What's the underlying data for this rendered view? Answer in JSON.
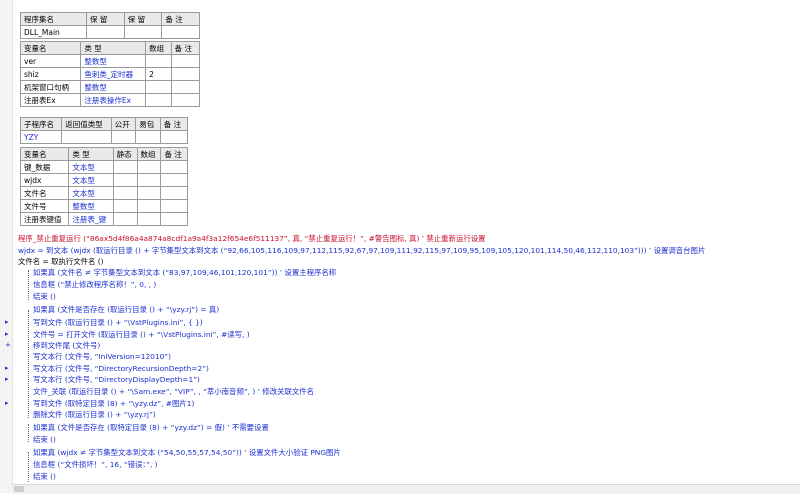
{
  "table_program": {
    "headers": [
      "程序集名",
      "保 留",
      "保 留",
      "备 注"
    ],
    "row": [
      "DLL_Main",
      "",
      "",
      ""
    ]
  },
  "table_vars": {
    "headers": [
      "变量名",
      "类 型",
      "数组",
      "备 注"
    ],
    "rows": [
      [
        "ver",
        "整数型",
        "",
        ""
      ],
      [
        "shiz",
        "鱼刺类_定时器",
        "2",
        ""
      ],
      [
        "机架窗口句柄",
        "整数型",
        "",
        ""
      ],
      [
        "注册表Ex",
        "注册表操作Ex",
        "",
        ""
      ]
    ]
  },
  "table_sub": {
    "headers": [
      "子程序名",
      "返回值类型",
      "公开",
      "易包",
      "备 注"
    ],
    "row": [
      "YZY",
      "",
      "",
      "",
      ""
    ]
  },
  "table_locals": {
    "headers": [
      "变量名",
      "类 型",
      "静态",
      "数组",
      "备 注"
    ],
    "rows": [
      [
        "键_数据",
        "文本型",
        "",
        "",
        ""
      ],
      [
        "wjdx",
        "文本型",
        "",
        "",
        ""
      ],
      [
        "文件名",
        "文本型",
        "",
        "",
        ""
      ],
      [
        "文件号",
        "整数型",
        "",
        "",
        ""
      ],
      [
        "注册表键值",
        "注册表_键",
        "",
        "",
        ""
      ]
    ]
  },
  "code_lines": [
    [
      "程序_禁止重复运行 (“86ax5d4f86a4a874a8cdf1a9a4f3a12f654e6f511137”, 真, “禁止重复运行！”, #警告图标, 真) ’ 禁止重新运行设置"
    ],
    [
      "wjdx = 到文本 (wjdx (取运行目录 () + 字节集型文本到文本 (“92,66,105,116,109,97,112,115,92,67,97,109,111,92,115,97,109,95,109,105,120,101,114,50,46,112,110,103”))) ’ 设置调音台图片"
    ],
    [
      "文件名 = 取执行文件名 ()"
    ],
    [
      "如果真 (文件名 ≠ 字节集型文本到文本 (“83,97,109,46,101,120,101”)) ’ 设置主程序名称"
    ],
    [
      "信息框 (“禁止修改程序名称！”, 0, , )"
    ],
    [
      "结束 ()"
    ],
    [
      "如果真 (文件是否存在 (取运行目录 () + “\\yzy.rj”) = 真)"
    ],
    [
      "写到文件 (取运行目录 () + “\\VstPlugins.ini”, { })"
    ],
    [
      "文件号 = 打开文件 (取运行目录 () + “\\VstPlugins.ini”, #读写, )"
    ],
    [
      "移到文件尾 (文件号)"
    ],
    [
      "写文本行 (文件号, “IniVersion=12010”)"
    ],
    [
      "写文本行 (文件号, “DirectoryRecursionDepth=2”)"
    ],
    [
      "写文本行 (文件号, “DirectoryDisplayDepth=1”)"
    ],
    [
      "文件_关联 (取运行目录 () + “\\Sam.exe”, “VIP”, , “萃小南音频”, ) ’ 修改关联文件名"
    ],
    [
      "写到文件 (取特定目录 (8) + “\\yzy.dz”, #图片1)"
    ],
    [
      "删除文件 (取运行目录 () + “\\yzy.rj”)"
    ],
    [
      "如果真 (文件是否存在 (取特定目录 (8) + “yzy.dz”) = 假) ’ 不需要设置"
    ],
    [
      "结束 ()"
    ],
    [
      "如果真 (wjdx ≠ 字节集型文本到文本 (“54,50,55,57,54,50”)) ’ 设置文件大小验证 PNG图片"
    ],
    [
      "信息框 (“文件损坏！”, 16, “错误：”, )"
    ],
    [
      "结束 ()"
    ]
  ],
  "colors": {
    "accent_blue": "#1b2fd1",
    "accent_red": "#c8102e",
    "comment_green": "#1a8a1a"
  }
}
